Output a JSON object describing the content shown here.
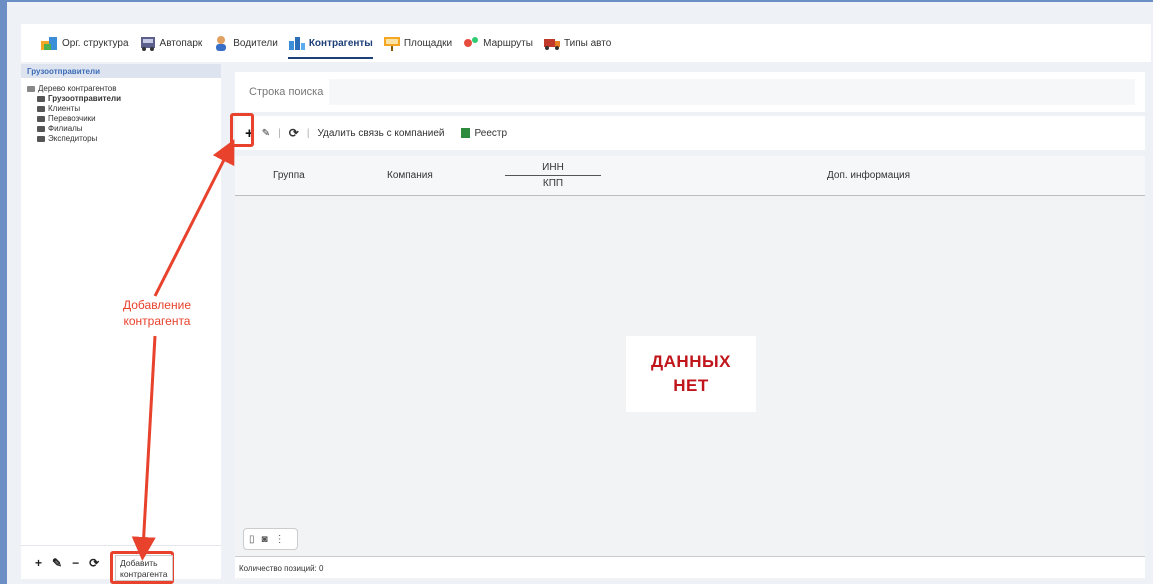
{
  "topnav": {
    "items": [
      {
        "label": "Орг. структура",
        "icon": "org-structure-icon"
      },
      {
        "label": "Автопарк",
        "icon": "fleet-icon"
      },
      {
        "label": "Водители",
        "icon": "driver-icon"
      },
      {
        "label": "Контрагенты",
        "icon": "counterparties-icon",
        "active": true
      },
      {
        "label": "Площадки",
        "icon": "sites-icon"
      },
      {
        "label": "Маршруты",
        "icon": "routes-icon"
      },
      {
        "label": "Типы авто",
        "icon": "vehicle-types-icon"
      }
    ]
  },
  "left_panel": {
    "header": "Грузоотправители",
    "tree_root": "Дерево контрагентов",
    "tree_items": [
      "Грузоотправители",
      "Клиенты",
      "Перевозчики",
      "Филиалы",
      "Экспедиторы"
    ],
    "toolbar": {
      "add": "+",
      "edit": "✎",
      "remove": "−",
      "refresh": "⟳"
    }
  },
  "main": {
    "search_label": "Строка поиска",
    "search_value": "",
    "toolbar": {
      "add": "+",
      "edit": "✎",
      "refresh": "⟳",
      "unlink": "Удалить связь с компанией",
      "registry": "Реестр"
    },
    "columns": {
      "group": "Группа",
      "company": "Компания",
      "inn": "ИНН",
      "kpp": "КПП",
      "extra": "Доп. информация"
    },
    "no_data_line1": "ДАННЫХ",
    "no_data_line2": "НЕТ",
    "status": "Количество позиций: 0"
  },
  "annotation": {
    "label_line1": "Добавление",
    "label_line2": "контрагента",
    "tooltip_line1": "Добавить",
    "tooltip_line2": "контрагента",
    "color": "#e8412c"
  }
}
